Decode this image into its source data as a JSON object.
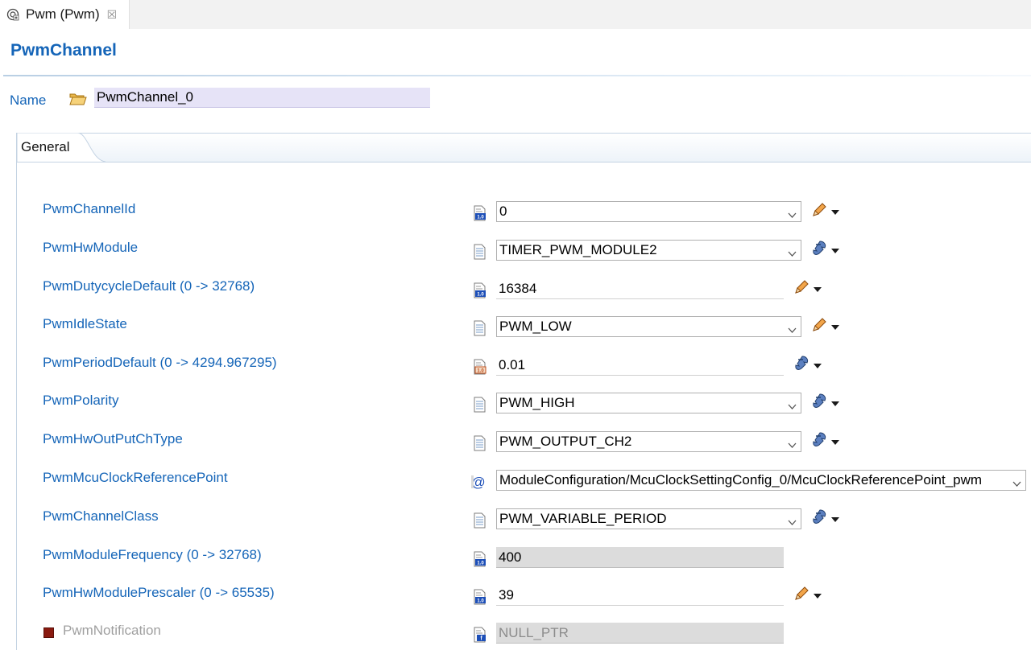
{
  "tab": {
    "title": "Pwm (Pwm)",
    "close_glyph": "☒"
  },
  "page_title": "PwmChannel",
  "name": {
    "label": "Name",
    "value": "PwmChannel_0"
  },
  "section": {
    "tab_label": "General"
  },
  "params": [
    {
      "label": "PwmChannelId",
      "value": "0",
      "kind": "combo",
      "icon": "integer-param-icon",
      "action": "pencil-icon"
    },
    {
      "label": "PwmHwModule",
      "value": "TIMER_PWM_MODULE2",
      "kind": "combo",
      "icon": "enum-param-icon",
      "action": "calculated-icon"
    },
    {
      "label": "PwmDutycycleDefault (0 -> 32768)",
      "value": "16384",
      "kind": "text",
      "icon": "integer-param-icon",
      "action": "pencil-icon"
    },
    {
      "label": "PwmIdleState",
      "value": "PWM_LOW",
      "kind": "combo",
      "icon": "enum-param-icon",
      "action": "pencil-icon"
    },
    {
      "label": "PwmPeriodDefault (0 -> 4294.967295)",
      "value": "0.01",
      "kind": "text",
      "icon": "float-param-icon",
      "action": "calculated-icon"
    },
    {
      "label": "PwmPolarity",
      "value": "PWM_HIGH",
      "kind": "combo",
      "icon": "enum-param-icon",
      "action": "calculated-icon"
    },
    {
      "label": "PwmHwOutPutChType",
      "value": "PWM_OUTPUT_CH2",
      "kind": "combo",
      "icon": "enum-param-icon",
      "action": "calculated-icon"
    },
    {
      "label": "PwmMcuClockReferencePoint",
      "value": "ModuleConfiguration/McuClockSettingConfig_0/McuClockReferencePoint_pwm",
      "kind": "combo-wide",
      "icon": "reference-param-icon",
      "action": ""
    },
    {
      "label": "PwmChannelClass",
      "value": "PWM_VARIABLE_PERIOD",
      "kind": "combo",
      "icon": "enum-param-icon",
      "action": "calculated-icon"
    },
    {
      "label": "PwmModuleFrequency (0 -> 32768)",
      "value": "400",
      "kind": "readonly",
      "icon": "integer-param-icon",
      "action": ""
    },
    {
      "label": "PwmHwModulePrescaler (0 -> 65535)",
      "value": "39",
      "kind": "text",
      "icon": "integer-param-icon",
      "action": "pencil-icon"
    },
    {
      "label": "PwmNotification",
      "value": "NULL_PTR",
      "kind": "readonly-disabled",
      "icon": "function-param-icon",
      "action": "",
      "optional_enabled": false
    }
  ],
  "colors": {
    "label_blue": "#1565b8",
    "name_field_bg": "#e6e3f7",
    "readonly_bg": "#dcdcdc"
  }
}
